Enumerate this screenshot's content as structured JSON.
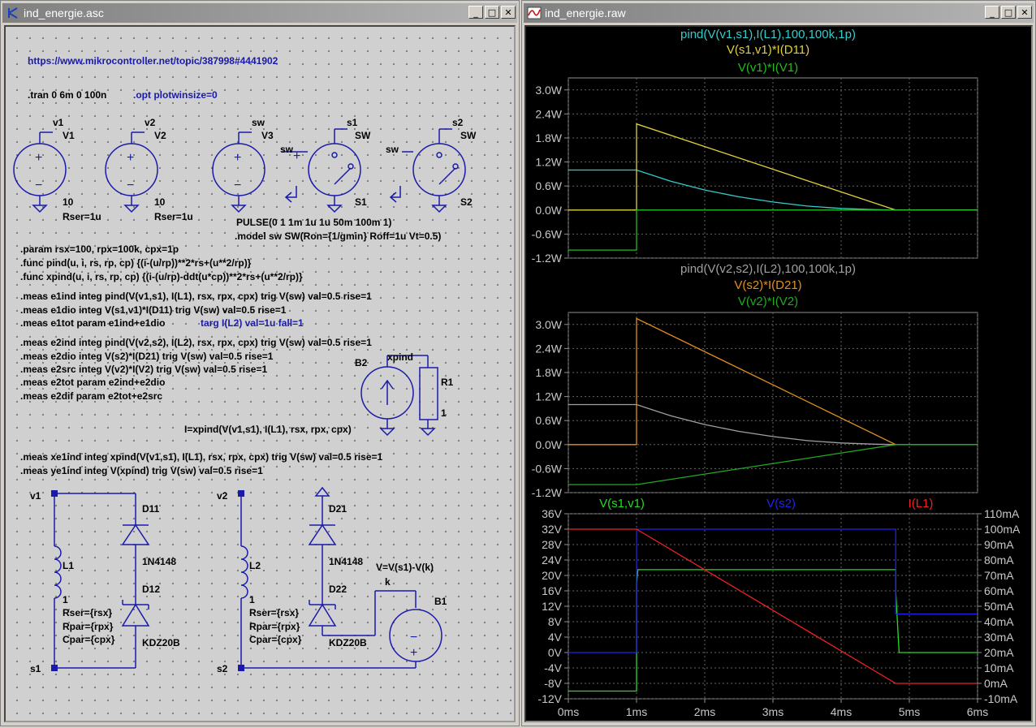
{
  "left_window": {
    "title": "ind_energie.asc",
    "btn_minimize": "_",
    "btn_maximize": "□",
    "btn_close": "✕",
    "url": "https://www.mikrocontroller.net/topic/387998#4441902",
    "tran": ".tran 0 6m 0 100n",
    "opt": ".opt plotwinsize=0",
    "labels": {
      "v1": "v1",
      "V1": "V1",
      "v2": "v2",
      "V2": "V2",
      "sw": "sw",
      "V3": "V3",
      "s1": "s1",
      "SW": "SW",
      "s2": "s2",
      "S1": "S1",
      "S2": "S2",
      "ten": "10",
      "rser1u": "Rser=1u",
      "plus": "+",
      "minus": "−",
      "B2": "B2",
      "xpind": "xpind",
      "R1": "R1",
      "one": "1",
      "D11": "D11",
      "D12": "D12",
      "D21": "D21",
      "D22": "D22",
      "n4148": "1N4148",
      "kdz": "KDZ20B",
      "L1": "L1",
      "L2": "L2",
      "rser": "Rser={rsx}",
      "rpar": "Rpar={rpx}",
      "cpar": "Cpar={cpx}",
      "B1": "B1",
      "k": "k",
      "vexpr": "V=V(s1)-V(k)"
    },
    "pulse": "PULSE(0 1 1m 1u 1u 50m 100m 1)",
    "model": ".model sw SW(Ron={1/gmin} Roff=1u Vt=0.5)",
    "directives": [
      ".param rsx=100, rpx=100k, cpx=1p",
      ".func pind(u, i, rs, rp, cp) {(i-(u/rp))**2*rs+(u**2/rp)}",
      ".func xpind(u, i, rs, rp, cp) {(i-(u/rp)-ddt(u*cp))**2*rs+(u**2/rp)}",
      ".meas e1ind integ pind(V(v1,s1), I(L1), rsx, rpx, cpx)  trig V(sw) val=0.5 rise=1",
      ".meas e1dio integ V(s1,v1)*I(D11) trig V(sw) val=0.5 rise=1",
      ".meas e1tot param e1ind+e1dio",
      "targ I(L2) val=1u fall=1",
      ".meas e2ind integ pind(V(v2,s2), I(L2), rsx, rpx, cpx)  trig V(sw) val=0.5 rise=1",
      ".meas e2dio integ V(s2)*I(D21) trig V(sw) val=0.5 rise=1",
      ".meas e2src integ V(v2)*I(V2) trig V(sw) val=0.5 rise=1",
      ".meas e2tot param e2ind+e2dio",
      ".meas e2dif param e2tot+e2src",
      "I=xpind(V(v1,s1), I(L1), rsx, rpx, cpx)",
      ".meas xe1ind integ xpind(V(v1,s1), I(L1), rsx, rpx, cpx)  trig V(sw) val=0.5 rise=1",
      ".meas ye1ind integ V(xpind) trig V(sw) val=0.5 rise=1"
    ]
  },
  "right_window": {
    "title": "ind_energie.raw",
    "btn_minimize": "_",
    "btn_maximize": "□",
    "btn_close": "✕"
  },
  "chart_data": [
    {
      "type": "line",
      "title": "",
      "xlim": [
        0,
        6
      ],
      "ylim": [
        -1.2,
        3.3
      ],
      "yticks": [
        "-1.2W",
        "-0.6W",
        "0.0W",
        "0.6W",
        "1.2W",
        "1.8W",
        "2.4W",
        "3.0W"
      ],
      "series": [
        {
          "name": "pind(V(v1,s1),I(L1),100,100k,1p)",
          "color": "#33cccc",
          "x": [
            0,
            1,
            1,
            1.5,
            2,
            2.5,
            3,
            3.5,
            4,
            4.5,
            4.8,
            6
          ],
          "y": [
            1.0,
            1.0,
            1.0,
            0.72,
            0.5,
            0.33,
            0.2,
            0.1,
            0.04,
            0.01,
            0,
            0
          ]
        },
        {
          "name": "V(s1,v1)*I(D11)",
          "color": "#e0d040",
          "x": [
            0,
            1,
            1,
            4.8,
            6
          ],
          "y": [
            0,
            0,
            2.15,
            0,
            0
          ]
        },
        {
          "name": "V(v1)*I(V1)",
          "color": "#22bb22",
          "x": [
            0,
            1,
            1,
            6
          ],
          "y": [
            -1.0,
            -1.0,
            0,
            0
          ]
        }
      ]
    },
    {
      "type": "line",
      "title": "",
      "xlim": [
        0,
        6
      ],
      "ylim": [
        -1.2,
        3.3
      ],
      "yticks": [
        "-1.2W",
        "-0.6W",
        "0.0W",
        "0.6W",
        "1.2W",
        "1.8W",
        "2.4W",
        "3.0W"
      ],
      "series": [
        {
          "name": "pind(V(v2,s2),I(L2),100,100k,1p)",
          "color": "#a0a0a0",
          "x": [
            0,
            1,
            1,
            1.5,
            2,
            2.5,
            3,
            3.5,
            4,
            4.5,
            4.8,
            6
          ],
          "y": [
            1.0,
            1.0,
            1.0,
            0.72,
            0.5,
            0.33,
            0.2,
            0.1,
            0.04,
            0.01,
            0,
            0
          ]
        },
        {
          "name": "V(s2)*I(D21)",
          "color": "#e09020",
          "x": [
            0,
            1,
            1,
            4.8,
            6
          ],
          "y": [
            0,
            0,
            3.15,
            0,
            0
          ]
        },
        {
          "name": "V(v2)*I(V2)",
          "color": "#22aa22",
          "x": [
            0,
            1,
            4.8,
            6
          ],
          "y": [
            -1.0,
            -1.0,
            0,
            0
          ]
        }
      ]
    },
    {
      "type": "line",
      "title": "",
      "xlim": [
        0,
        6
      ],
      "xticks": [
        "0ms",
        "1ms",
        "2ms",
        "3ms",
        "4ms",
        "5ms",
        "6ms"
      ],
      "ylim": [
        -12,
        36
      ],
      "yticks": [
        "-12V",
        "-8V",
        "-4V",
        "0V",
        "4V",
        "8V",
        "12V",
        "16V",
        "20V",
        "24V",
        "28V",
        "32V",
        "36V"
      ],
      "y2lim": [
        -10,
        110
      ],
      "y2ticks": [
        "-10mA",
        "0mA",
        "10mA",
        "20mA",
        "30mA",
        "40mA",
        "50mA",
        "60mA",
        "70mA",
        "80mA",
        "90mA",
        "100mA",
        "110mA"
      ],
      "series": [
        {
          "name": "V(s1,v1)",
          "color": "#22dd22",
          "axis": "left",
          "x": [
            0,
            1,
            1,
            1.02,
            4.8,
            4.8,
            4.85,
            6
          ],
          "y": [
            -10,
            -10,
            18,
            21.5,
            21.5,
            16,
            0,
            0
          ]
        },
        {
          "name": "V(s2)",
          "color": "#2222ee",
          "axis": "left",
          "x": [
            0,
            1,
            1,
            4.8,
            4.8,
            6
          ],
          "y": [
            0,
            0,
            32,
            32,
            10,
            10
          ]
        },
        {
          "name": "I(L1)",
          "color": "#ee2222",
          "axis": "right",
          "x": [
            0,
            1,
            4.8,
            6
          ],
          "y": [
            100,
            100,
            0,
            0
          ]
        }
      ]
    }
  ]
}
